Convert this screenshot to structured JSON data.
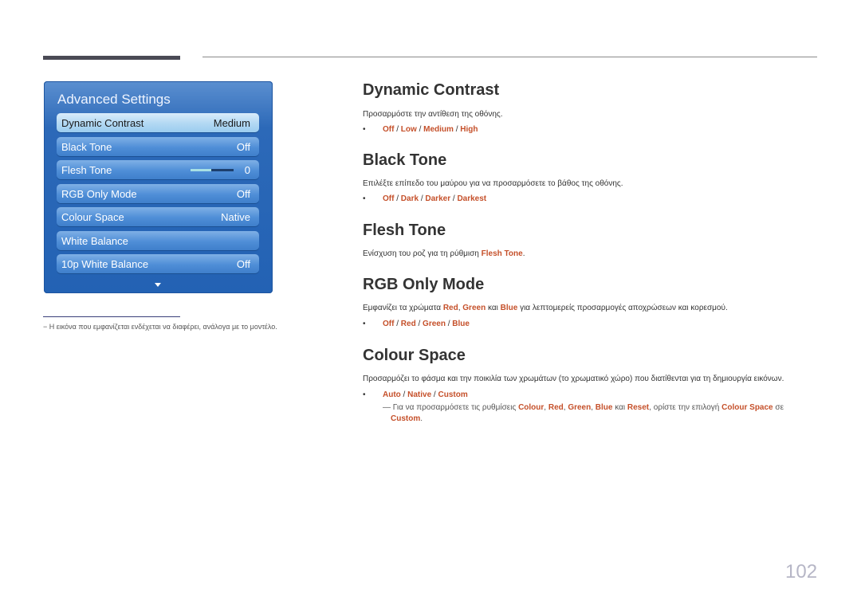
{
  "osd_menu": {
    "title": "Advanced Settings",
    "items": [
      {
        "label": "Dynamic Contrast",
        "value": "Medium",
        "selected": true
      },
      {
        "label": "Black Tone",
        "value": "Off"
      },
      {
        "label": "Flesh Tone",
        "value": "0",
        "slider_fraction": 0.48
      },
      {
        "label": "RGB Only Mode",
        "value": "Off"
      },
      {
        "label": "Colour Space",
        "value": "Native"
      },
      {
        "label": "White Balance",
        "value": ""
      },
      {
        "label": "10p White Balance",
        "value": "Off"
      }
    ],
    "scroll_icon": "chevron-down-icon"
  },
  "footnote": "− Η εικόνα που εμφανίζεται ενδέχεται να διαφέρει, ανάλογα με το μοντέλο.",
  "sections": {
    "dynamic_contrast": {
      "title": "Dynamic Contrast",
      "desc": "Προσαρμόστε την αντίθεση της οθόνης.",
      "options": [
        "Off",
        "Low",
        "Medium",
        "High"
      ]
    },
    "black_tone": {
      "title": "Black Tone",
      "desc": "Επιλέξτε επίπεδο του μαύρου για να προσαρμόσετε το βάθος της οθόνης.",
      "options": [
        "Off",
        "Dark",
        "Darker",
        "Darkest"
      ]
    },
    "flesh_tone": {
      "title": "Flesh Tone",
      "desc_pre": "Ενίσχυση του ροζ για τη ρύθμιση ",
      "desc_hl": "Flesh Tone",
      "desc_post": "."
    },
    "rgb_only": {
      "title": "RGB Only Mode",
      "desc_pre": "Εμφανίζει τα χρώματα ",
      "red": "Red",
      "comma": ", ",
      "green": "Green",
      "kai": " και ",
      "blue": "Blue",
      "desc_post": " για λεπτομερείς προσαρμογές αποχρώσεων και κορεσμού.",
      "options": [
        "Off",
        "Red",
        "Green",
        "Blue"
      ]
    },
    "colour_space": {
      "title": "Colour Space",
      "desc": "Προσαρμόζει το φάσμα και την ποικιλία των χρωμάτων (το χρωματικό χώρο) που διατίθενται για τη δημιουργία εικόνων.",
      "options": [
        "Auto",
        "Native",
        "Custom"
      ],
      "note": {
        "dash": "―",
        "t1": " Για να προσαρμόσετε τις ρυθμίσεις ",
        "colour": "Colour",
        "c1": ", ",
        "red": "Red",
        "c2": ", ",
        "green": "Green",
        "c3": ", ",
        "blue": "Blue",
        "kai": " και ",
        "reset": "Reset",
        "t2": ", ορίστε την επιλογή ",
        "cs": "Colour Space",
        "se": " σε ",
        "custom": "Custom",
        "end": "."
      }
    }
  },
  "page_number": "102",
  "colors": {
    "accent": "#c5502a",
    "osd_blue": "#2362b4"
  }
}
